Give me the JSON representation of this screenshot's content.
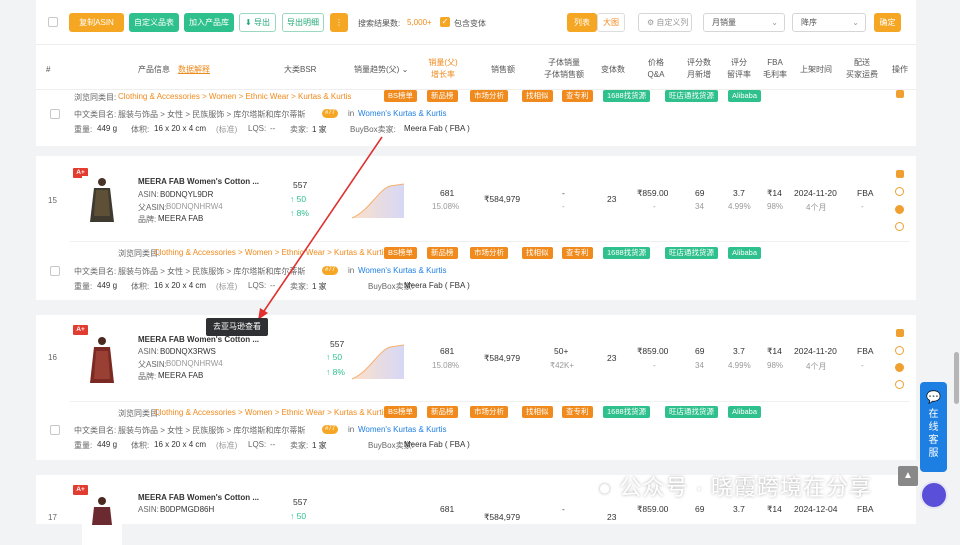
{
  "toolbar": {
    "copy_asin": "复制ASIN",
    "custom_table": "自定义品表",
    "add_library": "加入产品库",
    "export": "导出",
    "export_detail": "导出明细",
    "more": "⋮",
    "result_label": "搜索结果数:",
    "result_count": "5,000+",
    "include_variants": "包含变体",
    "view_list": "列表",
    "view_grid": "大图",
    "custom_fields": "自定义列",
    "sort_field": "月销量",
    "sort_order": "降序",
    "confirm": "确定"
  },
  "columns": {
    "index": "#",
    "product_info": "产品信息",
    "data_source": "数据解释",
    "category_bsr": "大类BSR",
    "sales_trend": "销量趋势(父)",
    "monthly_sales": "销量(父)",
    "growth_rate": "增长率",
    "revenue": "销售额",
    "variant_sales": "子体销量",
    "variant_revenue": "子体销售额",
    "variant_count": "变体数",
    "price": "价格",
    "qa": "Q&A",
    "rating_count": "评分数",
    "monthly_new": "月新增",
    "rating": "评分",
    "review_rate": "留评率",
    "fba": "FBA",
    "gross_margin": "毛利率",
    "launch_date": "上架时间",
    "delivery": "配送",
    "buyer_freight": "买家运费",
    "action": "操作"
  },
  "common": {
    "browse_label": "浏览同类目:",
    "browse_path": "Clothing & Accessories > Women > Ethnic Wear > Kurtas & Kurtis",
    "cn_label": "中文类目名:",
    "cn_path": "服装与饰品 > 女性 > 民族服饰 > 库尔塔斯和库尔蒂斯",
    "rank_badge": "#77",
    "rank_in": "in",
    "rank_cat": "Women's Kurtas & Kurtis",
    "weight_label": "重量:",
    "weight": "449 g",
    "volume_label": "体积:",
    "volume": "16 x 20 x 4 cm",
    "volume_std": "(标准)",
    "lqs_label": "LQS:",
    "lqs": "--",
    "seller_label": "卖家:",
    "seller_count": "1 家",
    "buybox_label": "BuyBox卖家:",
    "buybox": "Meera Fab ( FBA )",
    "tags": [
      "BS榜单",
      "新品榜",
      "市场分析",
      "找相似",
      "查专利",
      "1688找货源",
      "旺店通找货源",
      "Alibaba"
    ]
  },
  "rows": [
    {
      "index": "15",
      "badge": "A+",
      "title": "MEERA FAB Women's Cotton ...",
      "asin_label": "ASIN:",
      "asin": "B0DNQYL9DR",
      "parent_label": "父ASIN:",
      "parent_asin": "B0DNQNHRW4",
      "brand_label": "品牌:",
      "brand": "MEERA FAB",
      "bsr": "557",
      "up1": "↑ 50",
      "up2": "↑ 8%",
      "sales": "681",
      "growth": "15.08%",
      "revenue": "₹584,979",
      "variant_sales": "-",
      "variant_revenue": "-",
      "variants": "23",
      "price": "₹859.00",
      "qa": "-",
      "ratings": "69",
      "new_ratings": "34",
      "rating": "3.7",
      "review_rate": "4.99%",
      "fba": "₹14",
      "margin": "98%",
      "date": "2024-11-20",
      "age": "4个月",
      "delivery": "FBA",
      "freight": "-"
    },
    {
      "index": "16",
      "badge": "A+",
      "title": "MEERA FAB Women's Cotton ...",
      "asin_label": "ASIN:",
      "asin": "B0DNQX3RWS",
      "parent_label": "父ASIN:",
      "parent_asin": "B0DNQNHRW4",
      "brand_label": "品牌:",
      "brand": "MEERA FAB",
      "bsr": "557",
      "up1": "↑ 50",
      "up2": "↑ 8%",
      "sales": "681",
      "growth": "15.08%",
      "revenue": "₹584,979",
      "variant_sales": "50+",
      "variant_revenue": "₹42K+",
      "variants": "23",
      "price": "₹859.00",
      "qa": "-",
      "ratings": "69",
      "new_ratings": "34",
      "rating": "3.7",
      "review_rate": "4.99%",
      "fba": "₹14",
      "margin": "98%",
      "date": "2024-11-20",
      "age": "4个月",
      "delivery": "FBA",
      "freight": "-"
    },
    {
      "index": "17",
      "badge": "A+",
      "title": "MEERA FAB Women's Cotton ...",
      "asin_label": "ASIN:",
      "asin": "B0DPMGD86H",
      "bsr": "557",
      "up1": "↑ 50",
      "sales": "681",
      "revenue": "₹584,979",
      "variant_sales": "-",
      "variants": "23",
      "price": "₹859.00",
      "ratings": "69",
      "rating": "3.7",
      "fba": "₹14",
      "date": "2024-12-04",
      "delivery": "FBA"
    }
  ],
  "tooltip": "去亚马逊查看",
  "support": "在线客服",
  "watermark": "公众号 · 晓霞跨境在分享",
  "colors": {
    "orange": "#f08a1c",
    "green": "#2ec08d",
    "blue": "#1e7fe3",
    "red": "#e23b2f"
  }
}
